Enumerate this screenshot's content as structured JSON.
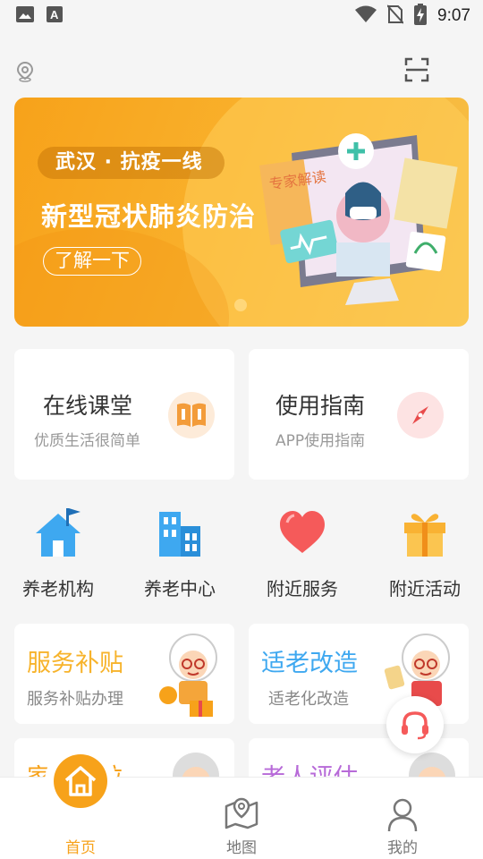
{
  "status_bar": {
    "time": "9:07",
    "icons": [
      "image-icon",
      "a-text-icon",
      "wifi-icon",
      "no-sim-icon",
      "battery-charging-icon"
    ]
  },
  "topbar": {
    "icons": [
      "location-icon",
      "scan-icon"
    ]
  },
  "banner": {
    "tag": "武汉 · 抗疫一线",
    "title": "新型冠状肺炎防治",
    "button": "了解一下",
    "art_text": "专家解读",
    "colors": {
      "bg_start": "#f7a21a",
      "bg_end": "#f6c04a"
    }
  },
  "feature_cards": [
    {
      "title": "在线课堂",
      "subtitle": "优质生活很简单",
      "icon": "book-icon",
      "icon_color": "#f39c3a"
    },
    {
      "title": "使用指南",
      "subtitle": "APP使用指南",
      "icon": "compass-icon",
      "icon_color": "#e84b4b"
    }
  ],
  "quick_grid": [
    {
      "label": "养老机构",
      "icon": "house-icon",
      "color": "#3ea8f0"
    },
    {
      "label": "养老中心",
      "icon": "buildings-icon",
      "color": "#3ea8f0"
    },
    {
      "label": "附近服务",
      "icon": "heart-icon",
      "color": "#f55a5a"
    },
    {
      "label": "附近活动",
      "icon": "gift-icon",
      "color": "#f9b233"
    }
  ],
  "service_cards": [
    {
      "title": "服务补贴",
      "subtitle": "服务补贴办理",
      "title_color": "#f7b32b"
    },
    {
      "title": "适老改造",
      "subtitle": "适老化改造",
      "title_color": "#3ea8f0"
    },
    {
      "title": "家庭床位",
      "subtitle": "",
      "title_color": "#f7a21a"
    },
    {
      "title": "老人评估",
      "subtitle": "",
      "title_color": "#b76ad8"
    }
  ],
  "tabbar": {
    "tabs": [
      {
        "label": "首页",
        "icon": "home-icon",
        "active": true
      },
      {
        "label": "地图",
        "icon": "map-icon",
        "active": false
      },
      {
        "label": "我的",
        "icon": "user-icon",
        "active": false
      }
    ],
    "accent": "#f7a21a"
  }
}
